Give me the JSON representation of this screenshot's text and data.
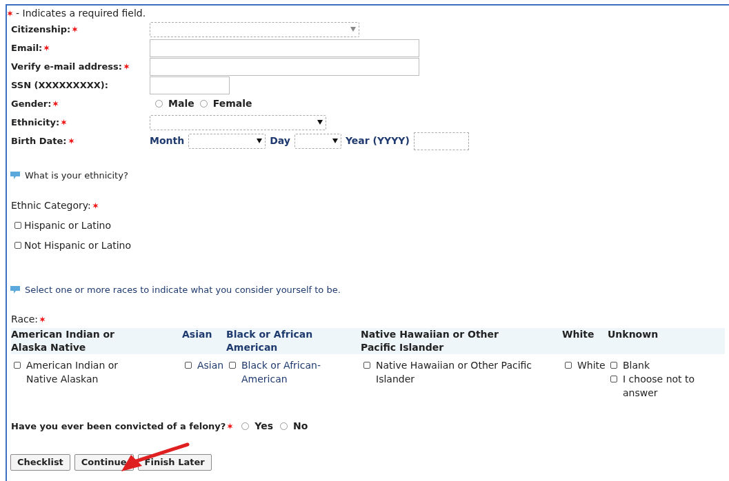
{
  "required_note": "- Indicates a required field.",
  "fields": [
    {
      "label": "Citizenship:",
      "required": true,
      "kind": "select"
    },
    {
      "label": "Email:",
      "required": true,
      "kind": "text"
    },
    {
      "label": "Verify e-mail address:",
      "required": true,
      "kind": "text"
    },
    {
      "label": "SSN (XXXXXXXXX):",
      "required": false,
      "kind": "short_text"
    },
    {
      "label": "Gender:",
      "required": true,
      "kind": "radio",
      "options": [
        {
          "label": "Male",
          "selected": false
        },
        {
          "label": "Female",
          "selected": false
        }
      ]
    },
    {
      "label": "Ethnicity:",
      "required": true,
      "kind": "select"
    },
    {
      "label": "Birth Date:",
      "required": true,
      "kind": "date",
      "month_label": "Month",
      "day_label": "Day",
      "year_label": "Year (YYYY)"
    }
  ],
  "ethnicity_hint": "What is your ethnicity?",
  "ethnic_category": {
    "label": "Ethnic Category:",
    "required": true,
    "options": [
      {
        "label": "Hispanic or Latino",
        "checked": false
      },
      {
        "label": "Not Hispanic or Latino",
        "checked": false
      }
    ]
  },
  "race_hint": "Select one or more races to indicate what you consider yourself to be.",
  "race": {
    "label": "Race:",
    "required": true,
    "columns": [
      {
        "header": "American Indian or Alaska Native",
        "options": [
          {
            "label": "American Indian or Native Alaskan",
            "checked": false
          }
        ]
      },
      {
        "header": "Asian",
        "options": [
          {
            "label": "Asian",
            "checked": false
          }
        ]
      },
      {
        "header": "Black or African American",
        "options": [
          {
            "label": "Black or African-American",
            "checked": false
          }
        ]
      },
      {
        "header": "Native Hawaiian or Other Pacific Islander",
        "options": [
          {
            "label": "Native Hawaiian or Other Pacific Islander",
            "checked": false
          }
        ]
      },
      {
        "header": "White",
        "options": [
          {
            "label": "White",
            "checked": false
          }
        ]
      },
      {
        "header": "Unknown",
        "options": [
          {
            "label": "Blank",
            "checked": false
          },
          {
            "label": "I choose not to answer",
            "checked": false
          }
        ]
      }
    ]
  },
  "felony": {
    "question": "Have you ever been convicted of a felony?",
    "required": true,
    "options": [
      {
        "label": "Yes",
        "selected": false
      },
      {
        "label": "No",
        "selected": false
      }
    ]
  },
  "buttons": [
    "Checklist",
    "Continue",
    "Finish Later"
  ]
}
